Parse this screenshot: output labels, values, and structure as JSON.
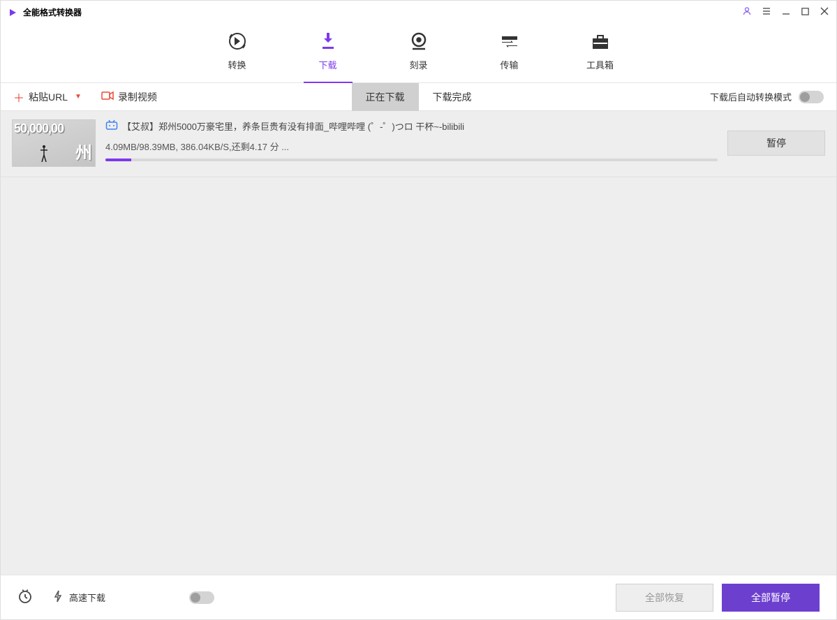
{
  "app": {
    "title": "全能格式转换器"
  },
  "nav": {
    "items": [
      {
        "label": "转换"
      },
      {
        "label": "下载"
      },
      {
        "label": "刻录"
      },
      {
        "label": "传输"
      },
      {
        "label": "工具箱"
      }
    ]
  },
  "toolbar": {
    "paste_url": "粘贴URL",
    "record_video": "录制视频",
    "tab_downloading": "正在下载",
    "tab_completed": "下载完成",
    "auto_convert_label": "下载后自动转换模式"
  },
  "downloads": [
    {
      "title": "【艾叔】郑州5000万豪宅里，养条巨贵有没有排面_哔哩哔哩 (゜-゜)つロ 干杯~-bilibili",
      "progress_text": "4.09MB/98.39MB, 386.04KB/S,还剩4.17 分 ...",
      "progress_percent": 4.2,
      "thumb_text": "50,000,00",
      "thumb_char": "州",
      "action_label": "暂停"
    }
  ],
  "footer": {
    "speed_label": "高速下载",
    "resume_all": "全部恢复",
    "pause_all": "全部暂停"
  }
}
